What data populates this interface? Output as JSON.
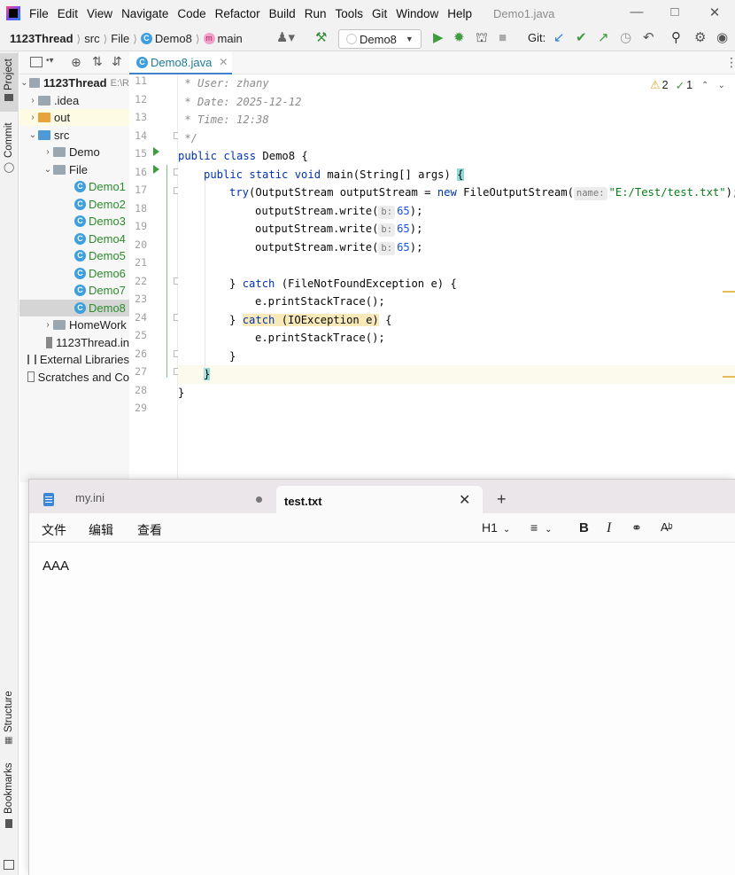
{
  "ide": {
    "menu": [
      "File",
      "Edit",
      "View",
      "Navigate",
      "Code",
      "Refactor",
      "Build",
      "Run",
      "Tools",
      "Git",
      "Window",
      "Help"
    ],
    "window_title": "Demo1.java",
    "breadcrumb": [
      "1123Thread",
      "src",
      "File",
      "Demo8",
      "main"
    ],
    "run_config": "Demo8",
    "git_label": "Git:",
    "stripe": {
      "project": "Project",
      "commit": "Commit",
      "structure": "Structure",
      "bookmarks": "Bookmarks"
    },
    "project_tree": [
      {
        "label": "1123Thread",
        "suffix": "E:\\R",
        "bold": true
      },
      {
        "label": ".idea"
      },
      {
        "label": "out"
      },
      {
        "label": "src"
      },
      {
        "label": "Demo"
      },
      {
        "label": "File"
      },
      {
        "label": "Demo1"
      },
      {
        "label": "Demo2"
      },
      {
        "label": "Demo3"
      },
      {
        "label": "Demo4"
      },
      {
        "label": "Demo5"
      },
      {
        "label": "Demo6"
      },
      {
        "label": "Demo7"
      },
      {
        "label": "Demo8"
      },
      {
        "label": "HomeWork"
      },
      {
        "label": "1123Thread.in"
      },
      {
        "label": "External Libraries"
      },
      {
        "label": "Scratches and Co"
      }
    ],
    "editor_tab": "Demo8.java",
    "inspections": {
      "warnings": "2",
      "typos": "1"
    },
    "line_numbers": [
      "11",
      "12",
      "13",
      "14",
      "15",
      "16",
      "17",
      "18",
      "19",
      "20",
      "21",
      "22",
      "23",
      "24",
      "25",
      "26",
      "27",
      "28",
      "29"
    ],
    "code": {
      "l11": " * User: zhany",
      "l12": " * Date: 2025-12-12",
      "l13": " * Time: 12:38",
      "l14": " */",
      "l15_kw": "public class",
      "l15_rest": " Demo8 {",
      "l16_kw": "public static void",
      "l16_rest": " main(String[] args) ",
      "l16_brace": "{",
      "l17_try": "try",
      "l17_mid": "(OutputStream outputStream = ",
      "l17_new": "new",
      "l17_cls": " FileOutputStream(",
      "l17_hint": "name:",
      "l17_str": "\"E:/Test/test.txt\"",
      "l17_end": ");",
      "write_call": "outputStream.write(",
      "write_hint": "b:",
      "write_val": "65",
      "write_end": ");",
      "l22_a": "} ",
      "l22_catch": "catch",
      "l22_rest": " (FileNotFoundException e) {",
      "l23": "e.printStackTrace();",
      "l24_a": "} ",
      "l24_catch": "catch",
      "l24_rest": " (IOException e)",
      "l24_end": " {",
      "l25": "e.printStackTrace();",
      "l26": "}",
      "l27": "}",
      "l28": "}"
    }
  },
  "notepad": {
    "tabs": [
      "my.ini",
      "test.txt"
    ],
    "menu": [
      "文件",
      "编辑",
      "查看"
    ],
    "heading_select": "H1",
    "content": "AAA"
  }
}
